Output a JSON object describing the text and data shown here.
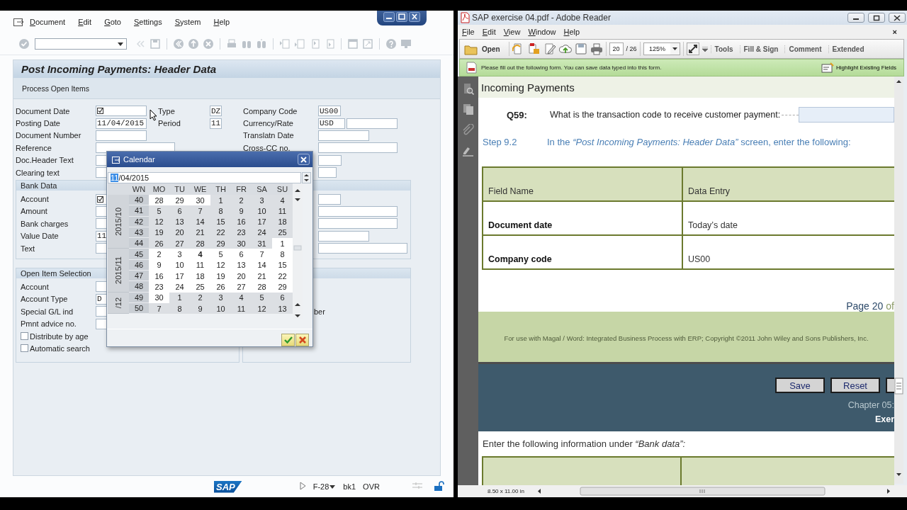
{
  "sap": {
    "menu": [
      "Document",
      "Edit",
      "Goto",
      "Settings",
      "System",
      "Help"
    ],
    "title": "Post Incoming Payments: Header Data",
    "buttons": [
      "Process Open Items"
    ],
    "header_left": [
      {
        "label": "Document Date",
        "required": true
      },
      {
        "label": "Posting Date",
        "value": "11/04/2015",
        "required": false
      },
      {
        "label": "Document Number",
        "required": false
      },
      {
        "label": "Reference",
        "required": false
      },
      {
        "label": "Doc.Header Text",
        "required": false
      },
      {
        "label": "Clearing text",
        "required": false
      }
    ],
    "header_middle": [
      {
        "label": "Type",
        "value": "DZ"
      },
      {
        "label": "Period",
        "value": "11"
      }
    ],
    "header_right": [
      {
        "label": "Company Code",
        "value": "US00"
      },
      {
        "label": "Currency/Rate",
        "value": "USD"
      },
      {
        "label": "Translatn Date"
      },
      {
        "label": "Cross-CC no."
      }
    ],
    "bank_data": {
      "title": "Bank Data",
      "fields": [
        {
          "label": "Account",
          "required": true
        },
        {
          "label": "Amount",
          "required": false
        },
        {
          "label": "Bank charges",
          "required": false
        },
        {
          "label": "Value Date",
          "value": "11",
          "required": false
        },
        {
          "label": "Text",
          "required": false
        }
      ]
    },
    "open_item_selection": {
      "title": "Open Item Selection",
      "fields": [
        {
          "label": "Account"
        },
        {
          "label": "Account Type",
          "value": "D"
        },
        {
          "label": "Special G/L ind"
        },
        {
          "label": "Pmnt advice no."
        }
      ],
      "options": [
        {
          "label": "Distribute by age",
          "checked": false
        },
        {
          "label": "Automatic search",
          "checked": false
        }
      ],
      "note": "ber"
    },
    "status_bar": {
      "logo": "SAP",
      "transaction": "F-28",
      "system": "bk1",
      "mode": "OVR"
    }
  },
  "calendar": {
    "title": "Calendar",
    "date": {
      "selected": "11",
      "rest": "/04/2015"
    },
    "week_header": "WN",
    "weekdays": [
      "MO",
      "TU",
      "WE",
      "TH",
      "FR",
      "SA",
      "SU"
    ],
    "months": [
      {
        "label": "2015/10",
        "weeks": [
          {
            "week": "40",
            "days": [
              {
                "day": "28",
                "shaded": false,
                "today": false
              },
              {
                "day": "29",
                "shaded": false,
                "today": false
              },
              {
                "day": "30",
                "shaded": false,
                "today": false
              },
              {
                "day": "1",
                "shaded": true,
                "today": false
              },
              {
                "day": "2",
                "shaded": true,
                "today": false
              },
              {
                "day": "3",
                "shaded": true,
                "today": false
              },
              {
                "day": "4",
                "shaded": true,
                "today": false
              }
            ]
          },
          {
            "week": "41",
            "days": [
              {
                "day": "5",
                "shaded": true,
                "today": false
              },
              {
                "day": "6",
                "shaded": true,
                "today": false
              },
              {
                "day": "7",
                "shaded": true,
                "today": false
              },
              {
                "day": "8",
                "shaded": true,
                "today": false
              },
              {
                "day": "9",
                "shaded": true,
                "today": false
              },
              {
                "day": "10",
                "shaded": true,
                "today": false
              },
              {
                "day": "11",
                "shaded": true,
                "today": false
              }
            ]
          },
          {
            "week": "42",
            "days": [
              {
                "day": "12",
                "shaded": true,
                "today": false
              },
              {
                "day": "13",
                "shaded": true,
                "today": false
              },
              {
                "day": "14",
                "shaded": true,
                "today": false
              },
              {
                "day": "15",
                "shaded": true,
                "today": false
              },
              {
                "day": "16",
                "shaded": true,
                "today": false
              },
              {
                "day": "17",
                "shaded": true,
                "today": false
              },
              {
                "day": "18",
                "shaded": true,
                "today": false
              }
            ]
          },
          {
            "week": "43",
            "days": [
              {
                "day": "19",
                "shaded": true,
                "today": false
              },
              {
                "day": "20",
                "shaded": true,
                "today": false
              },
              {
                "day": "21",
                "shaded": true,
                "today": false
              },
              {
                "day": "22",
                "shaded": true,
                "today": false
              },
              {
                "day": "23",
                "shaded": true,
                "today": false
              },
              {
                "day": "24",
                "shaded": true,
                "today": false
              },
              {
                "day": "25",
                "shaded": true,
                "today": false
              }
            ]
          },
          {
            "week": "44",
            "days": [
              {
                "day": "26",
                "shaded": true,
                "today": false
              },
              {
                "day": "27",
                "shaded": true,
                "today": false
              },
              {
                "day": "28",
                "shaded": true,
                "today": false
              },
              {
                "day": "29",
                "shaded": true,
                "today": false
              },
              {
                "day": "30",
                "shaded": true,
                "today": false
              },
              {
                "day": "31",
                "shaded": true,
                "today": false
              },
              {
                "day": "1",
                "shaded": false,
                "today": false
              }
            ]
          }
        ]
      },
      {
        "label": "2015/11",
        "weeks": [
          {
            "week": "45",
            "days": [
              {
                "day": "2",
                "shaded": false,
                "today": false
              },
              {
                "day": "3",
                "shaded": false,
                "today": false
              },
              {
                "day": "4",
                "shaded": false,
                "today": true
              },
              {
                "day": "5",
                "shaded": false,
                "today": false
              },
              {
                "day": "6",
                "shaded": false,
                "today": false
              },
              {
                "day": "7",
                "shaded": false,
                "today": false
              },
              {
                "day": "8",
                "shaded": false,
                "today": false
              }
            ]
          },
          {
            "week": "46",
            "days": [
              {
                "day": "9",
                "shaded": false,
                "today": false
              },
              {
                "day": "10",
                "shaded": false,
                "today": false
              },
              {
                "day": "11",
                "shaded": false,
                "today": false
              },
              {
                "day": "12",
                "shaded": false,
                "today": false
              },
              {
                "day": "13",
                "shaded": false,
                "today": false
              },
              {
                "day": "14",
                "shaded": false,
                "today": false
              },
              {
                "day": "15",
                "shaded": false,
                "today": false
              }
            ]
          },
          {
            "week": "47",
            "days": [
              {
                "day": "16",
                "shaded": false,
                "today": false
              },
              {
                "day": "17",
                "shaded": false,
                "today": false
              },
              {
                "day": "18",
                "shaded": false,
                "today": false
              },
              {
                "day": "19",
                "shaded": false,
                "today": false
              },
              {
                "day": "20",
                "shaded": false,
                "today": false
              },
              {
                "day": "21",
                "shaded": false,
                "today": false
              },
              {
                "day": "22",
                "shaded": false,
                "today": false
              }
            ]
          },
          {
            "week": "48",
            "days": [
              {
                "day": "23",
                "shaded": false,
                "today": false
              },
              {
                "day": "24",
                "shaded": false,
                "today": false
              },
              {
                "day": "25",
                "shaded": false,
                "today": false
              },
              {
                "day": "26",
                "shaded": false,
                "today": false
              },
              {
                "day": "27",
                "shaded": false,
                "today": false
              },
              {
                "day": "28",
                "shaded": false,
                "today": false
              },
              {
                "day": "29",
                "shaded": false,
                "today": false
              }
            ]
          }
        ]
      },
      {
        "label": "/12",
        "weeks": [
          {
            "week": "49",
            "days": [
              {
                "day": "30",
                "shaded": false,
                "today": false
              },
              {
                "day": "1",
                "shaded": true,
                "today": false
              },
              {
                "day": "2",
                "shaded": true,
                "today": false
              },
              {
                "day": "3",
                "shaded": true,
                "today": false
              },
              {
                "day": "4",
                "shaded": true,
                "today": false
              },
              {
                "day": "5",
                "shaded": true,
                "today": false
              },
              {
                "day": "6",
                "shaded": true,
                "today": false
              }
            ]
          },
          {
            "week": "50",
            "days": [
              {
                "day": "7",
                "shaded": true,
                "today": false
              },
              {
                "day": "8",
                "shaded": true,
                "today": false
              },
              {
                "day": "9",
                "shaded": true,
                "today": false
              },
              {
                "day": "10",
                "shaded": true,
                "today": false
              },
              {
                "day": "11",
                "shaded": true,
                "today": false
              },
              {
                "day": "12",
                "shaded": true,
                "today": false
              },
              {
                "day": "13",
                "shaded": true,
                "today": false
              }
            ]
          }
        ]
      }
    ]
  },
  "adobe": {
    "title": "SAP exercise 04.pdf - Adobe Reader",
    "menu": [
      "File",
      "Edit",
      "View",
      "Window",
      "Help"
    ],
    "menu_close": "×",
    "toolbar": {
      "open": "Open",
      "page": "20",
      "page_count": "/ 26",
      "zoom": "125%",
      "panels": [
        "Tools",
        "Fill & Sign",
        "Comment",
        "Extended"
      ]
    },
    "form_bar": {
      "message": "Please fill out the following form. You can save data typed into this form.",
      "action": "Highlight Existing Fields"
    },
    "document": {
      "heading": "Incoming Payments",
      "question": {
        "number": "Q59:",
        "text": "What is the transaction code to receive customer payment:"
      },
      "step": {
        "number": "Step 9.2",
        "text": "In the *“Post Incoming Payments: Header Data”* screen, enter the following:"
      },
      "table": {
        "columns": [
          "Field Name",
          "Data Entry"
        ],
        "rows": [
          [
            "Document date",
            "Today’s date"
          ],
          [
            "Company code",
            "US00"
          ]
        ]
      },
      "page_label": "Page 20",
      "page_of": "of",
      "footer": "For use with Magal / Word: Integrated Business Process with ERP; Copyright ©2011 John Wiley and Sons Publishers, Inc.",
      "buttons": [
        "Save",
        "Reset"
      ],
      "chapter": "Chapter 05:",
      "exercise": "Exer",
      "instruction": "Enter the following information under *“Bank data”:*"
    },
    "page_size": "8.50 x 11.00 in"
  }
}
